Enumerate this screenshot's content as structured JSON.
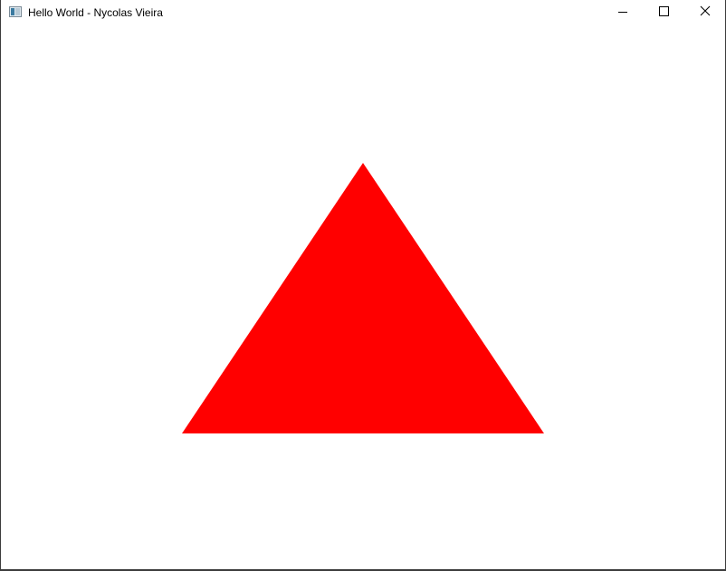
{
  "window": {
    "title": "Hello World - Nycolas Vieira",
    "icon": "app-window-icon",
    "controls": [
      {
        "name": "minimize",
        "icon": "minimize-icon"
      },
      {
        "name": "maximize",
        "icon": "maximize-icon"
      },
      {
        "name": "close",
        "icon": "close-icon"
      }
    ]
  },
  "canvas": {
    "background_color": "#ffffff",
    "shapes": [
      {
        "type": "triangle",
        "fill_color": "#ff0000"
      }
    ]
  }
}
